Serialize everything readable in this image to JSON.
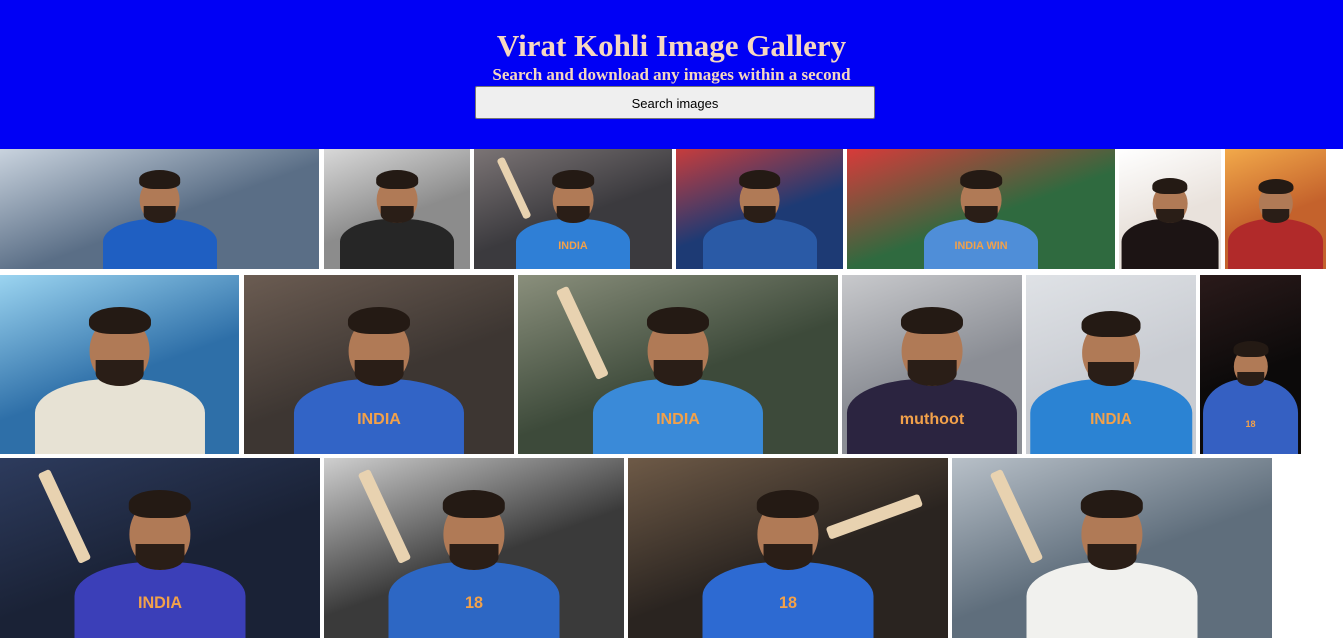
{
  "header": {
    "title": "Virat Kohli Image Gallery",
    "subtitle": "Search and download any images within a second",
    "search_button_label": "Search images"
  },
  "gallery": {
    "images": [
      {
        "alt": "virat-kohli-blue-jersey-closeup",
        "bg": "#5a6e86",
        "sky": "#c9d3de",
        "jersey": "#1f5fc2"
      },
      {
        "alt": "virat-kohli-black-jacket-bw",
        "bg": "#8c8c8c",
        "sky": "#d8d8d8",
        "jersey": "#262626"
      },
      {
        "alt": "virat-kohli-india-t20-jersey",
        "bg": "#3b3a3e",
        "sky": "#7b7475",
        "jersey": "#2f7fd6",
        "label": "INDIA"
      },
      {
        "alt": "virat-kohli-press-conference",
        "bg": "#1d3a74",
        "sky": "#c73c3c",
        "jersey": "#2a5aa6"
      },
      {
        "alt": "virat-kohli-india-win-banner",
        "bg": "#2f6a3f",
        "sky": "#d83a3a",
        "jersey": "#4f8ed8",
        "label": "INDIA WIN"
      },
      {
        "alt": "virat-kohli-rcb-black-red",
        "bg": "#e9e2dc",
        "sky": "#ffffff",
        "jersey": "#1c1414"
      },
      {
        "alt": "virat-kohli-sunset-celebration",
        "bg": "#c4622c",
        "sky": "#f2a94a",
        "jersey": "#b12a2a"
      },
      {
        "alt": "virat-kohli-laughing-studio",
        "bg": "#2e6fa8",
        "sky": "#9bd4f0",
        "jersey": "#e7e2d4"
      },
      {
        "alt": "virat-kohli-fist-pump",
        "bg": "#3d3632",
        "sky": "#6b5c52",
        "jersey": "#3264c6",
        "label": "INDIA"
      },
      {
        "alt": "virat-kohli-bat-raised-helmet",
        "bg": "#3d4a3a",
        "sky": "#8a8f7c",
        "jersey": "#3a8ad8",
        "label": "INDIA"
      },
      {
        "alt": "virat-kohli-rcb-muthoot",
        "bg": "#8b8e95",
        "sky": "#c8c9cc",
        "jersey": "#2b2440",
        "label": "muthoot"
      },
      {
        "alt": "virat-kohli-byjus-jersey",
        "bg": "#c9ccd2",
        "sky": "#dfe2e6",
        "jersey": "#2b83d3",
        "label": "INDIA"
      },
      {
        "alt": "virat-kohli-number-18-back",
        "bg": "#0c0a0a",
        "sky": "#2a1a1a",
        "jersey": "#3560c2",
        "label": "18"
      },
      {
        "alt": "virat-kohli-celebration-helmet-bat",
        "bg": "#1a2236",
        "sky": "#2d3b5d",
        "jersey": "#3b3fb8",
        "label": "INDIA"
      },
      {
        "alt": "virat-kohli-arms-raised-18",
        "bg": "#3a3a3a",
        "sky": "#cfcfcf",
        "jersey": "#2d67c4",
        "label": "18"
      },
      {
        "alt": "virat-kohli-pointing-bat",
        "bg": "#2a2420",
        "sky": "#6e5a47",
        "jersey": "#2d6ad2",
        "label": "18"
      },
      {
        "alt": "virat-kohli-test-whites-celebration",
        "bg": "#5f6e7c",
        "sky": "#b8c0c8",
        "jersey": "#f1f1ee"
      }
    ]
  }
}
